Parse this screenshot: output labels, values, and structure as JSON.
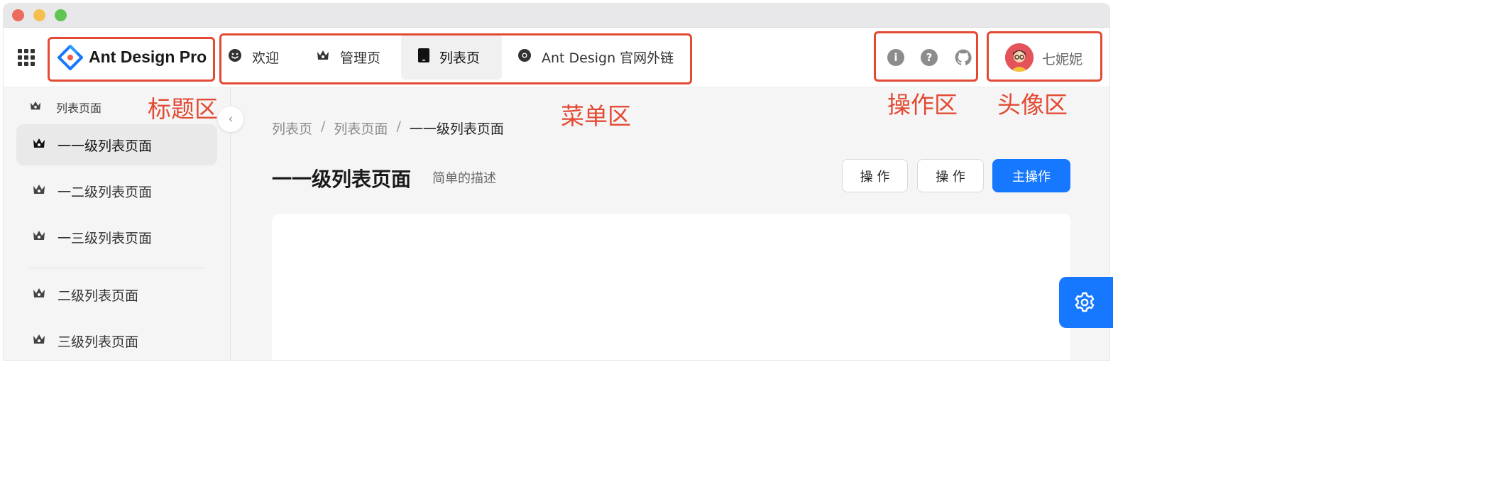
{
  "header": {
    "brand": "Ant Design Pro",
    "menu": [
      {
        "label": "欢迎",
        "icon": "smile-icon"
      },
      {
        "label": "管理页",
        "icon": "crown-icon"
      },
      {
        "label": "列表页",
        "icon": "tablet-icon",
        "active": true
      },
      {
        "label": "Ant Design 官网外链",
        "icon": "chrome-icon"
      }
    ],
    "actions": [
      "info-icon",
      "question-icon",
      "github-icon"
    ],
    "username": "七妮妮"
  },
  "annotations": {
    "title_area": "标题区",
    "menu_area": "菜单区",
    "action_area": "操作区",
    "avatar_area": "头像区"
  },
  "sidebar": {
    "group_label": "列表页面",
    "items": [
      {
        "label": "一一级列表页面",
        "active": true
      },
      {
        "label": "一二级列表页面"
      },
      {
        "label": "一三级列表页面"
      },
      {
        "label": "二级列表页面"
      },
      {
        "label": "三级列表页面"
      }
    ]
  },
  "breadcrumb": {
    "items": [
      "列表页",
      "列表页面",
      "一一级列表页面"
    ],
    "separator": "/"
  },
  "page": {
    "title": "一一级列表页面",
    "description": "简单的描述",
    "buttons": {
      "action1": "操 作",
      "action2": "操 作",
      "primary": "主操作"
    }
  },
  "colors": {
    "accent": "#1677ff",
    "annotation": "#e34a33"
  }
}
